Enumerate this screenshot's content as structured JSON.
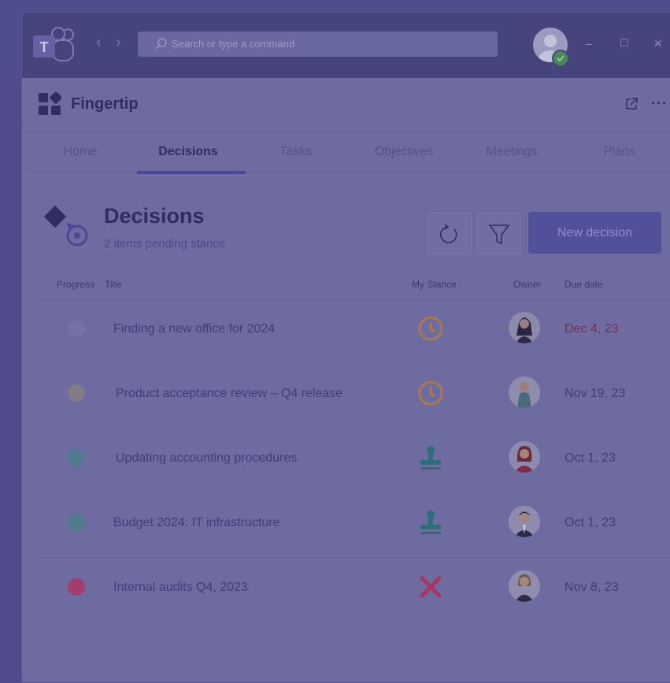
{
  "titlebar": {
    "search_placeholder": "Search or type a command",
    "nav_back_icon": "chevron-left-icon",
    "nav_forward_icon": "chevron-right-icon",
    "minimize": "–",
    "maximize": "☐",
    "close": "✕"
  },
  "app": {
    "name": "Fingertip",
    "more": "···"
  },
  "tabs": [
    {
      "label": "Home"
    },
    {
      "label": "Decisions",
      "active": true
    },
    {
      "label": "Tasks"
    },
    {
      "label": "Objectives"
    },
    {
      "label": "Meetings"
    },
    {
      "label": "Plans"
    }
  ],
  "page": {
    "title": "Decisions",
    "subtitle": "2 items pending stance",
    "new_button": "New decision"
  },
  "table": {
    "columns": {
      "progress": "Progress",
      "title": "Title",
      "stance": "My Stance",
      "owner": "Owner",
      "due": "Due date"
    },
    "rows": [
      {
        "title": "Finding a new office for 2024",
        "progress_color": "#7472a6",
        "stance": "clock-icon",
        "due": "Dec 4, 23",
        "overdue": true
      },
      {
        "title": "Product acceptance review – Q4 release",
        "progress_color": "#837a85",
        "stance": "clock-icon",
        "due": "Nov 19, 23",
        "overdue": false
      },
      {
        "title": "Updating accounting procedures",
        "progress_color": "#4f7b8c",
        "stance": "stamp-icon",
        "due": "Oct 1, 23",
        "overdue": false
      },
      {
        "title": "Budget 2024: IT infrastructure",
        "progress_color": "#4f7b8c",
        "stance": "stamp-icon",
        "due": "Oct 1, 23",
        "overdue": false
      },
      {
        "title": "Internal audits Q4, 2023",
        "progress_color": "#a33d6d",
        "stance": "cross-icon",
        "due": "Nov 8, 23",
        "overdue": false
      }
    ]
  },
  "colors": {
    "accent": "#52509b",
    "clock": "#a87a4a",
    "stamp": "#2e6e7a",
    "cross": "#a8365f",
    "overdue": "#7d2d4f"
  }
}
